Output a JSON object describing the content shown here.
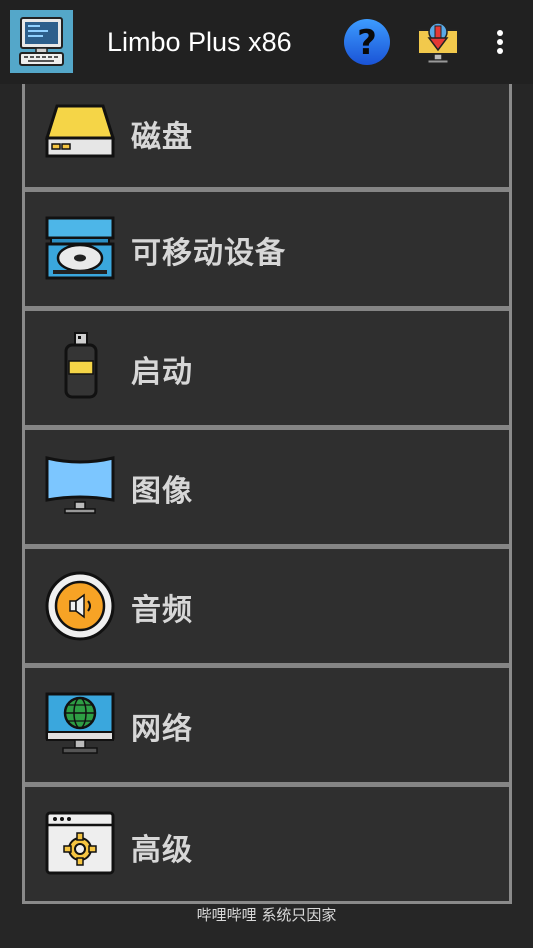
{
  "app": {
    "title": "Limbo Plus x86",
    "icon": "computer-app-icon"
  },
  "toolbar": {
    "help_icon": "help-icon",
    "download_icon": "download-icon",
    "more_icon": "more-vert-icon"
  },
  "menu": {
    "items": [
      {
        "label": "磁盘",
        "icon": "disk-drive-icon"
      },
      {
        "label": "可移动设备",
        "icon": "optical-drive-icon"
      },
      {
        "label": "启动",
        "icon": "usb-boot-icon"
      },
      {
        "label": "图像",
        "icon": "monitor-icon"
      },
      {
        "label": "音频",
        "icon": "speaker-icon"
      },
      {
        "label": "网络",
        "icon": "network-globe-icon"
      },
      {
        "label": "高级",
        "icon": "settings-window-icon"
      }
    ]
  },
  "footer": {
    "text": "哔哩哔哩 系统只因家"
  }
}
